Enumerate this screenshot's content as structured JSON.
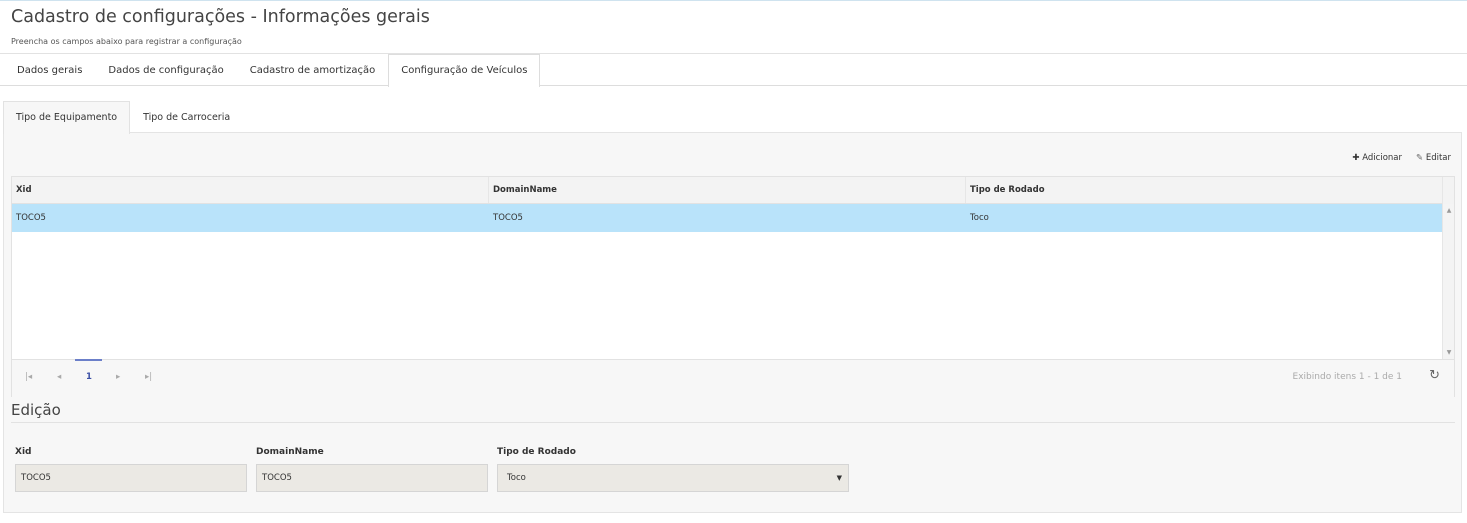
{
  "header": {
    "title": "Cadastro de configurações - Informações gerais",
    "subtitle": "Preencha os campos abaixo para registrar a configuração"
  },
  "tabs": [
    "Dados gerais",
    "Dados de configuração",
    "Cadastro de amortização",
    "Configuração de Veículos"
  ],
  "inner_tabs": [
    "Tipo de Equipamento",
    "Tipo de Carroceria"
  ],
  "toolbar": {
    "add": "Adicionar",
    "edit": "Editar"
  },
  "grid": {
    "columns": [
      "Xid",
      "DomainName",
      "Tipo de Rodado"
    ],
    "rows": [
      [
        "TOCO5",
        "TOCO5",
        "Toco"
      ]
    ]
  },
  "pager": {
    "page": "1",
    "info": "Exibindo itens 1 - 1 de 1"
  },
  "edit": {
    "title": "Edição",
    "xid_label": "Xid",
    "xid": "TOCO5",
    "domain_label": "DomainName",
    "domain": "TOCO5",
    "rodado_label": "Tipo de Rodado",
    "rodado": "Toco"
  }
}
